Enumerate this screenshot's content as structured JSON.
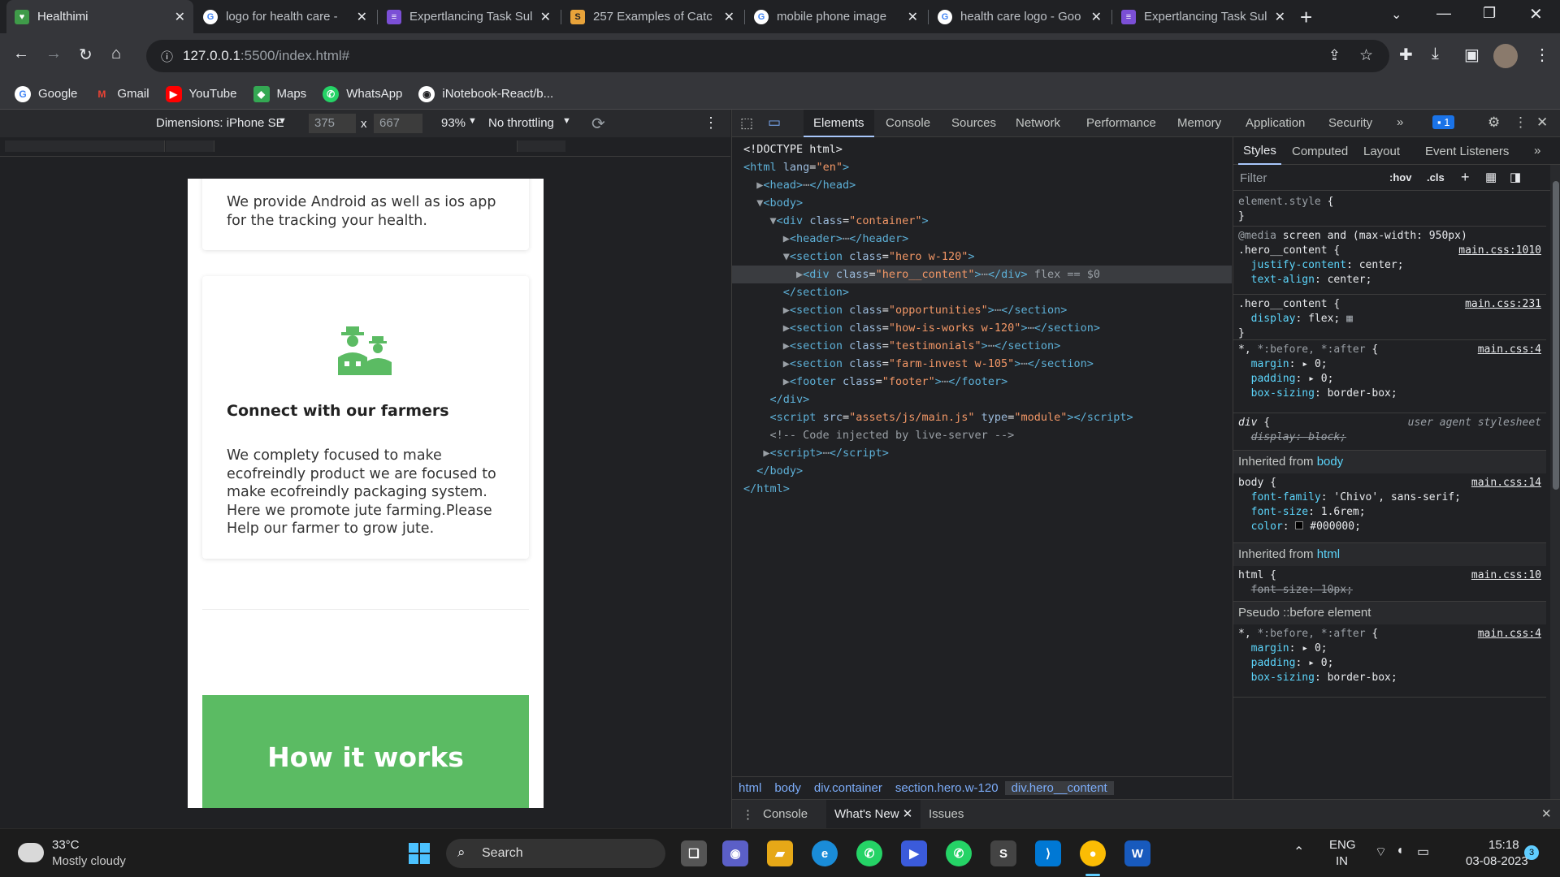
{
  "browser": {
    "tabs": [
      {
        "title": "Healthimi",
        "active": true
      },
      {
        "title": "logo for health care -",
        "active": false
      },
      {
        "title": "Expertlancing Task Sul",
        "active": false
      },
      {
        "title": "257 Examples of Catc",
        "active": false
      },
      {
        "title": "mobile phone image",
        "active": false
      },
      {
        "title": "health care logo - Goo",
        "active": false
      },
      {
        "title": "Expertlancing Task Sul",
        "active": false
      }
    ],
    "url_host": "127.0.0.1",
    "url_path": ":5500/index.html#",
    "bookmarks": [
      "Google",
      "Gmail",
      "YouTube",
      "Maps",
      "WhatsApp",
      "iNotebook-React/b..."
    ]
  },
  "device_toolbar": {
    "dimensions": "Dimensions: iPhone SE",
    "width": "375",
    "height": "667",
    "zoom": "93%",
    "throttle": "No throttling"
  },
  "page": {
    "card1_text": "We provide Android as well as ios app for the tracking your health.",
    "card2_title": "Connect with our farmers",
    "card2_text": "We complety focused to make ecofreindly product we are focused to make ecofreindly packaging system. Here we promote jute farming.Please Help our farmer to grow jute.",
    "how_title": "How it works"
  },
  "devtools": {
    "tabs": [
      "Elements",
      "Console",
      "Sources",
      "Network",
      "Performance",
      "Memory",
      "Application",
      "Security"
    ],
    "issues_count": "1",
    "dom": [
      {
        "html": "<span class='tx'>&lt;!DOCTYPE html&gt;</span>"
      },
      {
        "html": "<span class='tag'>&lt;html</span> <span class='an'>lang</span>=<span class='av'>\"en\"</span><span class='tag'>&gt;</span>"
      },
      {
        "html": "  <span class='cm'>▶</span><span class='tag'>&lt;head&gt;</span><span class='cm'>⋯</span><span class='tag'>&lt;/head&gt;</span>"
      },
      {
        "html": "  <span class='cm'>▼</span><span class='tag'>&lt;body&gt;</span>"
      },
      {
        "html": "    <span class='cm'>▼</span><span class='tag'>&lt;div</span> <span class='an'>class</span>=<span class='av'>\"container\"</span><span class='tag'>&gt;</span>"
      },
      {
        "html": "      <span class='cm'>▶</span><span class='tag'>&lt;header&gt;</span><span class='cm'>⋯</span><span class='tag'>&lt;/header&gt;</span>"
      },
      {
        "html": "      <span class='cm'>▼</span><span class='tag'>&lt;section</span> <span class='an'>class</span>=<span class='av'>\"hero w-120\"</span><span class='tag'>&gt;</span>"
      },
      {
        "html": "        <span class='cm'>▶</span><span class='tag'>&lt;div</span> <span class='an'>class</span>=<span class='av'>\"hero__content\"</span><span class='tag'>&gt;</span><span class='cm'>⋯</span><span class='tag'>&lt;/div&gt;</span> <span class='cm'>flex == $0</span>",
        "sel": true
      },
      {
        "html": "      <span class='tag'>&lt;/section&gt;</span>"
      },
      {
        "html": "      <span class='cm'>▶</span><span class='tag'>&lt;section</span> <span class='an'>class</span>=<span class='av'>\"opportunities\"</span><span class='tag'>&gt;</span><span class='cm'>⋯</span><span class='tag'>&lt;/section&gt;</span>"
      },
      {
        "html": "      <span class='cm'>▶</span><span class='tag'>&lt;section</span> <span class='an'>class</span>=<span class='av'>\"how-is-works w-120\"</span><span class='tag'>&gt;</span><span class='cm'>⋯</span><span class='tag'>&lt;/section&gt;</span>"
      },
      {
        "html": "      <span class='cm'>▶</span><span class='tag'>&lt;section</span> <span class='an'>class</span>=<span class='av'>\"testimonials\"</span><span class='tag'>&gt;</span><span class='cm'>⋯</span><span class='tag'>&lt;/section&gt;</span>"
      },
      {
        "html": "      <span class='cm'>▶</span><span class='tag'>&lt;section</span> <span class='an'>class</span>=<span class='av'>\"farm-invest w-105\"</span><span class='tag'>&gt;</span><span class='cm'>⋯</span><span class='tag'>&lt;/section&gt;</span>"
      },
      {
        "html": "      <span class='cm'>▶</span><span class='tag'>&lt;footer</span> <span class='an'>class</span>=<span class='av'>\"footer\"</span><span class='tag'>&gt;</span><span class='cm'>⋯</span><span class='tag'>&lt;/footer&gt;</span>"
      },
      {
        "html": "    <span class='tag'>&lt;/div&gt;</span>"
      },
      {
        "html": "    <span class='tag'>&lt;script</span> <span class='an'>src</span>=<span class='av'>\"assets/js/main.js\"</span> <span class='an'>type</span>=<span class='av'>\"module\"</span><span class='tag'>&gt;&lt;/script&gt;</span>"
      },
      {
        "html": "    <span class='cm'>&lt;!-- Code injected by live-server --&gt;</span>"
      },
      {
        "html": "   <span class='cm'>▶</span><span class='tag'>&lt;script&gt;</span><span class='cm'>⋯</span><span class='tag'>&lt;/script&gt;</span>"
      },
      {
        "html": "  <span class='tag'>&lt;/body&gt;</span>"
      },
      {
        "html": "<span class='tag'>&lt;/html&gt;</span>"
      }
    ],
    "breadcrumbs": [
      "html",
      "body",
      "div.container",
      "section.hero.w-120",
      "div.hero__content"
    ],
    "style_tabs": [
      "Styles",
      "Computed",
      "Layout",
      "Event Listeners"
    ],
    "filter_placeholder": "Filter",
    "hov": ":hov",
    "cls": ".cls",
    "drawer_tabs": [
      "Console",
      "What's New",
      "Issues"
    ]
  },
  "taskbar": {
    "temp": "33°C",
    "weather": "Mostly cloudy",
    "search": "Search",
    "lang1": "ENG",
    "lang2": "IN",
    "time": "15:18",
    "date": "03-08-2023",
    "notif": "3"
  }
}
